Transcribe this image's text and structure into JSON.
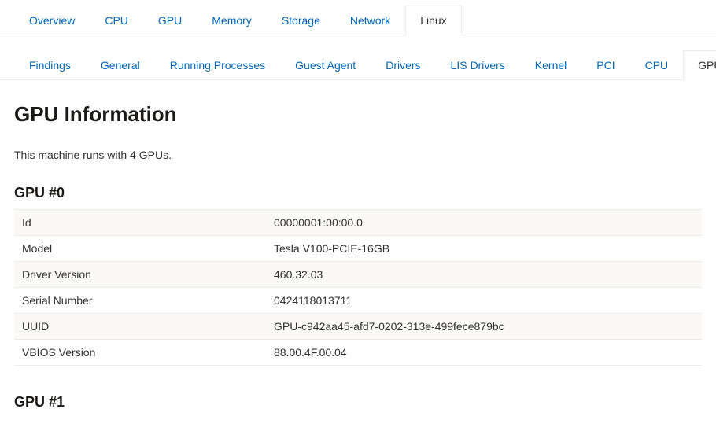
{
  "primaryTabs": {
    "items": [
      {
        "label": "Overview",
        "key": "overview"
      },
      {
        "label": "CPU",
        "key": "cpu"
      },
      {
        "label": "GPU",
        "key": "gpu"
      },
      {
        "label": "Memory",
        "key": "memory"
      },
      {
        "label": "Storage",
        "key": "storage"
      },
      {
        "label": "Network",
        "key": "network"
      },
      {
        "label": "Linux",
        "key": "linux"
      }
    ],
    "activeIndex": 6
  },
  "secondaryTabs": {
    "items": [
      {
        "label": "Findings",
        "key": "findings"
      },
      {
        "label": "General",
        "key": "general"
      },
      {
        "label": "Running Processes",
        "key": "running-processes"
      },
      {
        "label": "Guest Agent",
        "key": "guest-agent"
      },
      {
        "label": "Drivers",
        "key": "drivers"
      },
      {
        "label": "LIS Drivers",
        "key": "lis-drivers"
      },
      {
        "label": "Kernel",
        "key": "kernel"
      },
      {
        "label": "PCI",
        "key": "pci"
      },
      {
        "label": "CPU",
        "key": "cpu"
      },
      {
        "label": "GPU",
        "key": "gpu"
      }
    ],
    "activeIndex": 9
  },
  "page": {
    "title": "GPU Information",
    "summary": "This machine runs with 4 GPUs."
  },
  "gpu0": {
    "heading": "GPU #0",
    "rows": {
      "idLabel": "Id",
      "idValue": "00000001:00:00.0",
      "modelLabel": "Model",
      "modelValue": "Tesla V100-PCIE-16GB",
      "driverLabel": "Driver Version",
      "driverValue": "460.32.03",
      "serialLabel": "Serial Number",
      "serialValue": "0424118013711",
      "uuidLabel": "UUID",
      "uuidValue": "GPU-c942aa45-afd7-0202-313e-499fece879bc",
      "vbiosLabel": "VBIOS Version",
      "vbiosValue": "88.00.4F.00.04"
    }
  },
  "gpu1": {
    "heading": "GPU #1"
  }
}
